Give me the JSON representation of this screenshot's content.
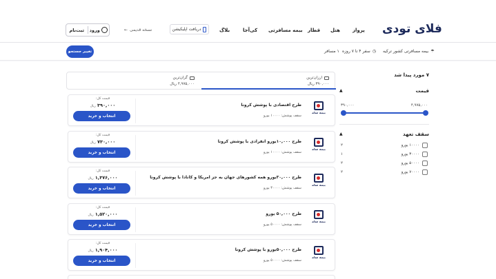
{
  "header": {
    "logo": "فلای تودی",
    "nav": [
      "پرواز",
      "هتل",
      "قطار",
      "بیمه مسافرتی",
      "کی‌آجا",
      "بلاگ"
    ],
    "app_download": "دریافت اپلیکیشن",
    "old_version": "نسخه قدیمی",
    "login": "ورود",
    "signup": "ثبت‌نام"
  },
  "search_summary": {
    "product": "بیمه مسافرتی کشور ترکیه",
    "duration": "سفر ۴ تا ۷ روزه",
    "travelers": "۱ مسافر",
    "change_button": "تغییر جستجو"
  },
  "filters": {
    "result_count": "۷ مورد پیدا شد",
    "price_title": "قیمت",
    "price_min": "۳۹۰,۰۰۰",
    "price_max": "۴,۹۷۵,۰۰۰",
    "coverage_title": "سقف تعهد",
    "coverage_options": [
      {
        "label": "۱۰۰۰۰ یورو",
        "count": "۲"
      },
      {
        "label": "۳۰۰۰۰ یورو",
        "count": "۱"
      },
      {
        "label": "۵۰۰۰۰ یورو",
        "count": "۲"
      },
      {
        "label": "۷۰۰۰۰ یورو",
        "count": "۲"
      }
    ]
  },
  "sort": {
    "cheapest_label": "ارزان‌ترین",
    "cheapest_price": "۳۹۰,۰۰۰",
    "expensive_label": "گران‌ترین",
    "expensive_price": "۴,۹۷۵,۰۰۰",
    "currency": "ریال"
  },
  "results": {
    "price_label": "قیمت کل:",
    "currency": "ریال",
    "buy_label": "انتخاب و خرید",
    "insurer": "بیمه سامان",
    "items": [
      {
        "title": "طرح اقتصادی با پوشش کرونا",
        "coverage": "سقف پوشش: ۱۰۰۰۰ یورو",
        "price": "۳۹۰,۰۰۰"
      },
      {
        "title": "طرح ۱۰,۰۰۰یورو انفرادی با پوشش کرونا",
        "coverage": "سقف پوشش: ۱۰۰۰۰ یورو",
        "price": "۷۳۰,۰۰۰"
      },
      {
        "title": "طرح ۳۰,۰۰۰یورو همه کشورهای جهان به جز امریکا و کانادا با پوشش کرونا",
        "coverage": "سقف پوشش: ۳۰۰۰۰ یورو",
        "price": "۱,۳۷۶,۰۰۰"
      },
      {
        "title": "طرح ۵۰,۰۰۰ یورو",
        "coverage": "سقف پوشش: ۵۰۰۰۰ یورو",
        "price": "۱,۵۲۰,۰۰۰"
      },
      {
        "title": "طرح ۵۰,۰۰۰یورو با پوشش کرونا",
        "coverage": "سقف پوشش: ۵۰۰۰۰ یورو",
        "price": "۱,۹۰۴,۰۰۰"
      }
    ]
  }
}
